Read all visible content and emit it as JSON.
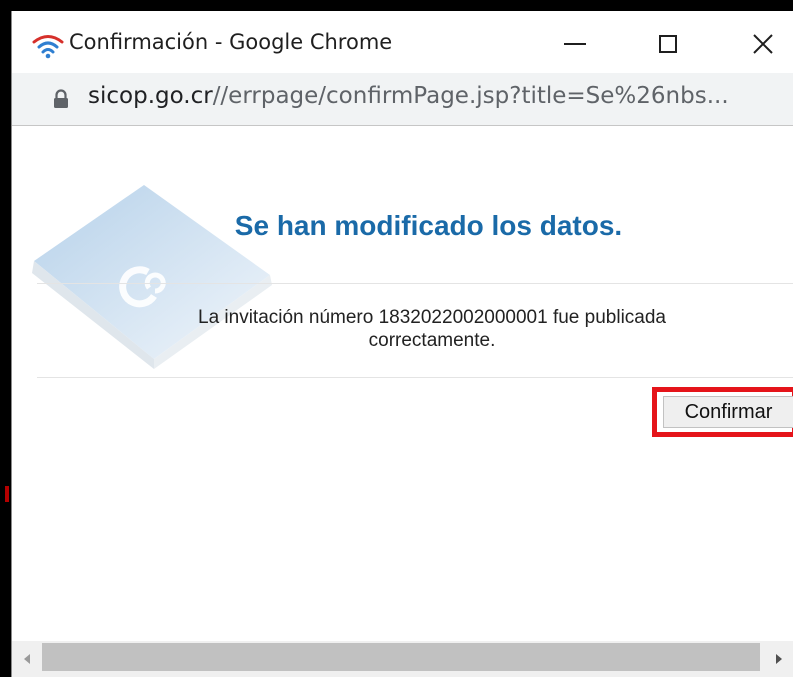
{
  "window": {
    "title": "Confirmación - Google Chrome",
    "controls": {
      "minimize": "minimize",
      "maximize": "maximize",
      "close": "×"
    }
  },
  "addressbar": {
    "url_domain": "sicop.go.cr",
    "url_path": "//errpage/confirmPage.jsp?title=Se%26nbs..."
  },
  "dialog": {
    "heading": "Se han modificado los datos.",
    "message_line1": "La invitación número 1832022002000001 fue publicada",
    "message_line2": "correctamente.",
    "confirm_label": "Confirmar"
  },
  "icons": {
    "title_icon": "wifi-signal-icon",
    "lock_icon": "lock-icon",
    "watermark": "book-logo-watermark",
    "scroll_left": "chevron-left-icon",
    "scroll_right": "chevron-right-icon"
  },
  "colors": {
    "heading": "#1a6aa8",
    "highlight": "#e5141a",
    "addressbar_bg": "#f1f3f4"
  }
}
